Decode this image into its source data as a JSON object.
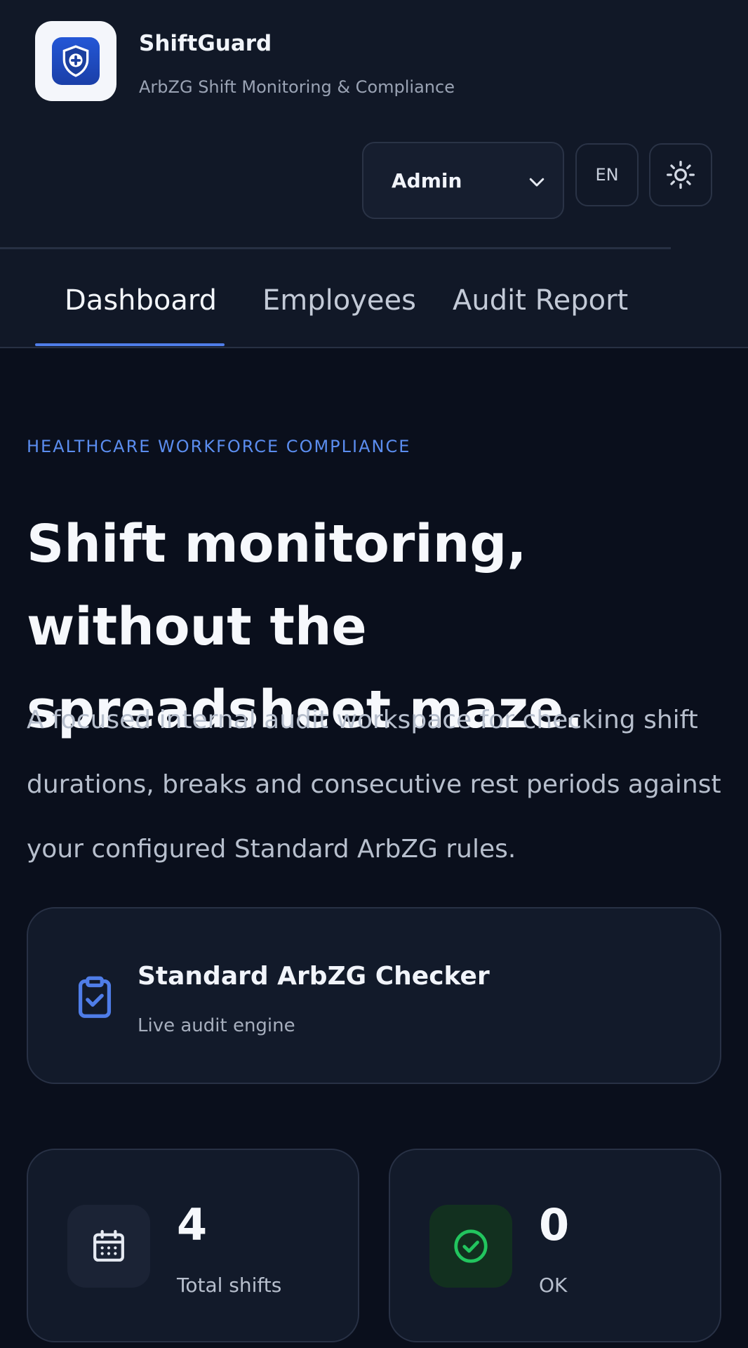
{
  "app": {
    "title": "ShiftGuard",
    "subtitle": "ArbZG Shift Monitoring & Compliance"
  },
  "controls": {
    "role_value": "Admin",
    "language_label": "EN",
    "theme_icon": "sun-icon"
  },
  "tabs": [
    {
      "label": "Dashboard",
      "active": true
    },
    {
      "label": "Employees",
      "active": false
    },
    {
      "label": "Audit Report",
      "active": false
    }
  ],
  "hero": {
    "eyebrow": "HEALTHCARE WORKFORCE COMPLIANCE",
    "headline": "Shift monitoring, without the spreadsheet maze.",
    "description": "A focused internal audit workspace for checking shift durations, breaks and consecutive rest periods against your configured Standard ArbZG rules."
  },
  "checker": {
    "icon": "clipboard-check-icon",
    "title": "Standard ArbZG Checker",
    "subtitle": "Live audit engine"
  },
  "stats": [
    {
      "icon": "calendar-icon",
      "value": "4",
      "label": "Total shifts"
    },
    {
      "icon": "check-circle-icon",
      "value": "0",
      "label": "OK"
    }
  ],
  "colors": {
    "accent": "#4f7de8",
    "eyebrow": "#5b8def",
    "success": "#22c55e",
    "background": "#0a0f1c",
    "header": "#111827"
  }
}
